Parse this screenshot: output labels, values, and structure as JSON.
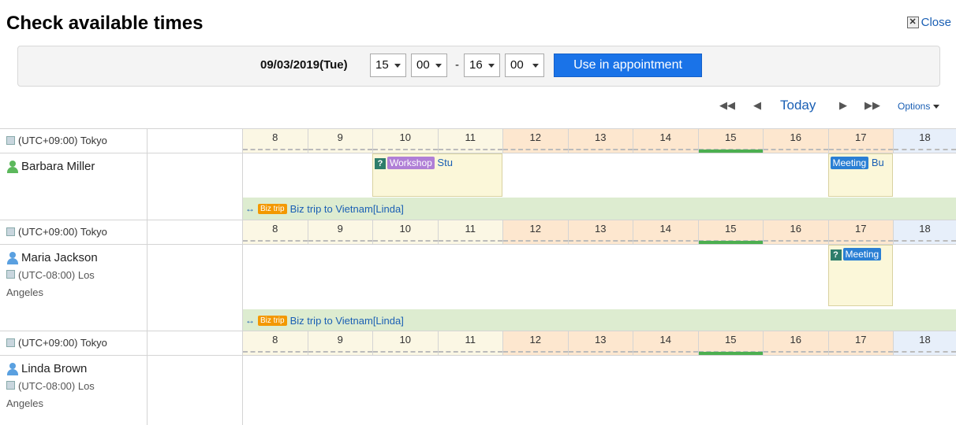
{
  "title": "Check available times",
  "close_label": "Close",
  "date": "09/03/2019(Tue)",
  "start_hour": "15",
  "start_minute": "00",
  "dash": "-",
  "end_hour": "16",
  "end_minute": "00",
  "use_button": "Use in appointment",
  "nav": {
    "prev_week": "◀◀",
    "prev_day": "◀",
    "today": "Today",
    "next_day": "▶",
    "next_week": "▶▶",
    "options": "Options"
  },
  "hours": [
    "8",
    "9",
    "10",
    "11",
    "12",
    "13",
    "14",
    "15",
    "16",
    "17",
    "18"
  ],
  "timezone_tokyo": "(UTC+09:00) Tokyo",
  "users": [
    {
      "name": "Barbara Miller",
      "sub_tz": "",
      "events": [
        {
          "tag": "Workshop",
          "text": "Stu"
        },
        {
          "tag": "Meeting",
          "text": "Bu"
        }
      ],
      "biz_tag": "Biz trip",
      "biz_text": "Biz trip to Vietnam[Linda]"
    },
    {
      "name": "Maria Jackson",
      "sub_tz": "(UTC-08:00) Los Angeles",
      "events": [
        {
          "tag": "Meeting",
          "text": ""
        }
      ],
      "biz_tag": "Biz trip",
      "biz_text": "Biz trip to Vietnam[Linda]"
    },
    {
      "name": "Linda Brown",
      "sub_tz": "(UTC-08:00) Los Angeles",
      "events": [],
      "biz_tag": "Biz trip",
      "biz_text": "Biz trip to Vietnam[Linda]"
    }
  ],
  "colors": {
    "workshop": "#b07fd6",
    "meeting": "#2a7fd4",
    "biz": "#f39800",
    "now_bar": "#4caf50"
  }
}
